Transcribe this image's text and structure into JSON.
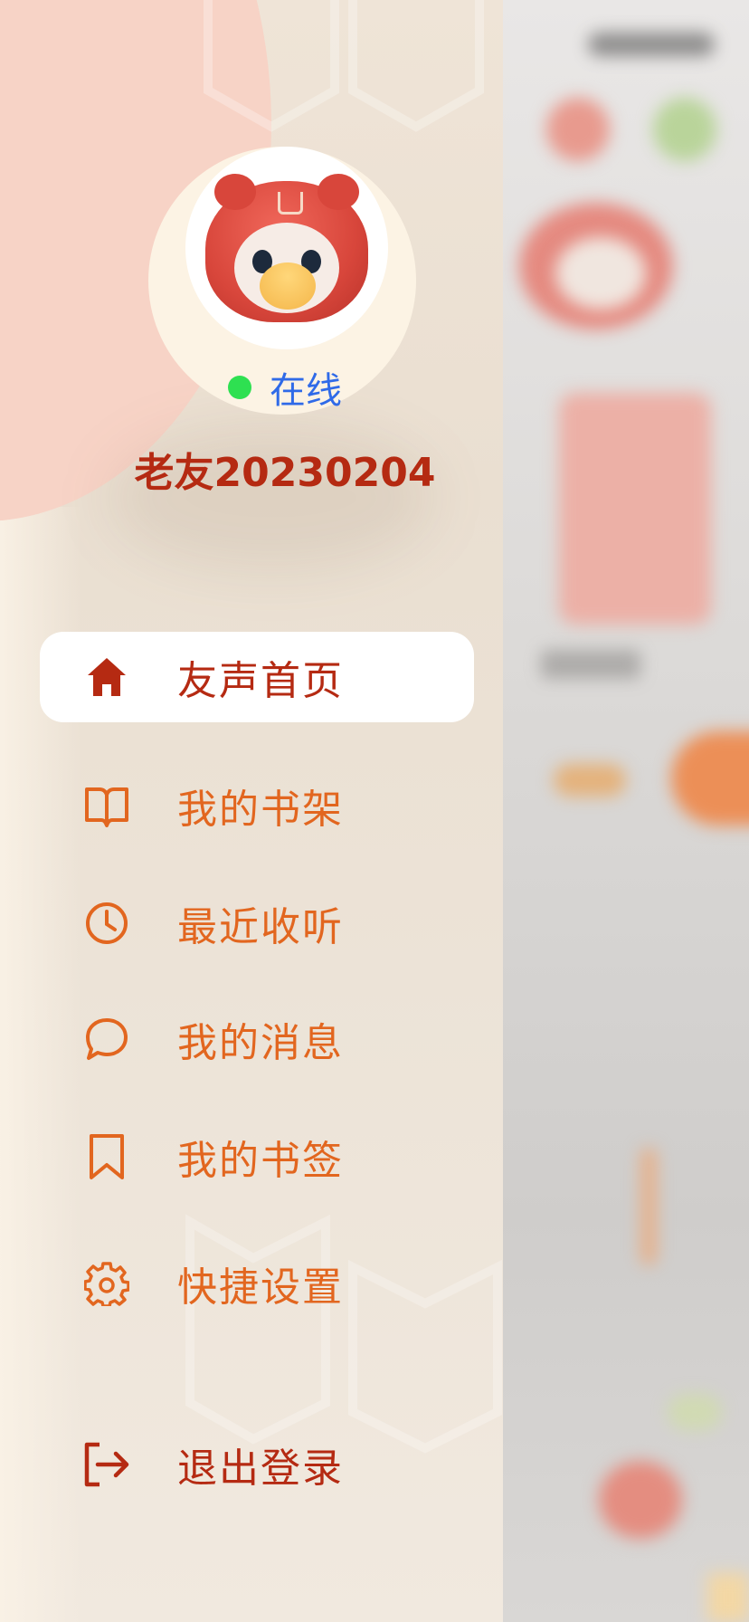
{
  "profile": {
    "status_text": "在线",
    "username": "老友20230204"
  },
  "menu": {
    "items": [
      {
        "label": "友声首页",
        "icon": "home-icon",
        "active": true
      },
      {
        "label": "我的书架",
        "icon": "book-icon",
        "active": false
      },
      {
        "label": "最近收听",
        "icon": "clock-icon",
        "active": false
      },
      {
        "label": "我的消息",
        "icon": "chat-bubble-icon",
        "active": false
      },
      {
        "label": "我的书签",
        "icon": "bookmark-icon",
        "active": false
      },
      {
        "label": "快捷设置",
        "icon": "gear-icon",
        "active": false
      }
    ],
    "logout": {
      "label": "退出登录",
      "icon": "logout-icon"
    }
  },
  "colors": {
    "accent_dark": "#b52a12",
    "accent_orange": "#e2661f",
    "online_green": "#2ee051",
    "status_blue": "#2f6ae8"
  }
}
